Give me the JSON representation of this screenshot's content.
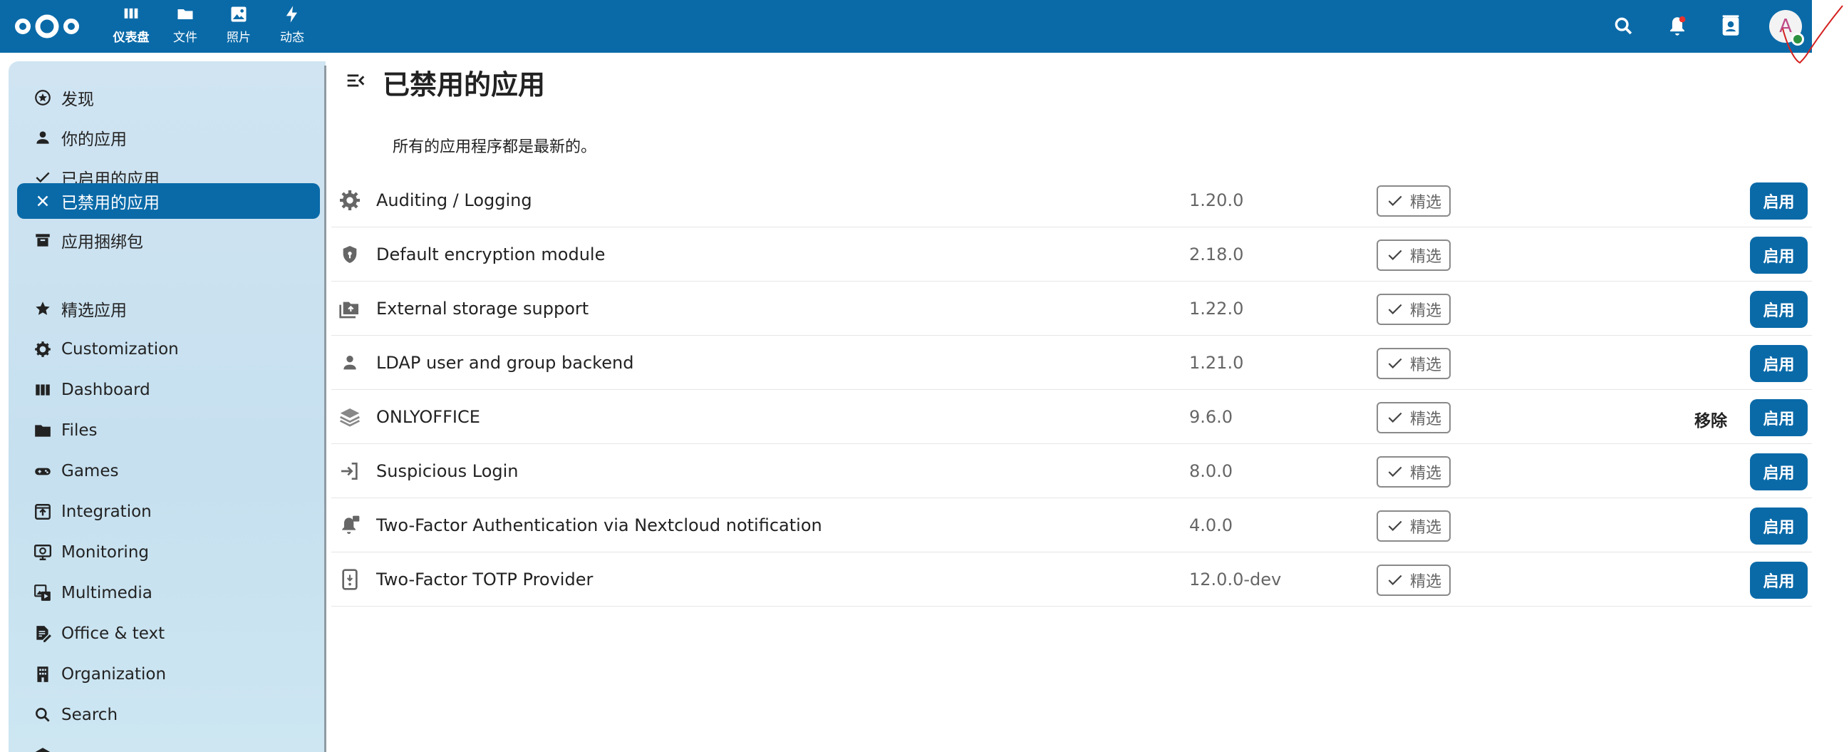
{
  "header": {
    "apps": [
      {
        "label": "仪表盘",
        "icon": "dashboard-icon",
        "active": true
      },
      {
        "label": "文件",
        "icon": "folder-icon",
        "active": false
      },
      {
        "label": "照片",
        "icon": "image-icon",
        "active": false
      },
      {
        "label": "动态",
        "icon": "lightning-icon",
        "active": false
      }
    ],
    "icons": [
      "search-icon",
      "bell-icon",
      "contacts-icon"
    ],
    "avatar_letter": "A",
    "brand_color": "#0a6aa8"
  },
  "sidebar": {
    "items": [
      {
        "label": "发现",
        "icon": "star-circle-icon"
      },
      {
        "label": "你的应用",
        "icon": "user-icon"
      },
      {
        "label": "已启用的应用",
        "icon": "check-icon"
      },
      {
        "label": "已禁用的应用",
        "icon": "close-icon",
        "active": true
      },
      {
        "label": "应用捆绑包",
        "icon": "archive-icon"
      }
    ],
    "categories": [
      {
        "label": "精选应用",
        "icon": "star-icon"
      },
      {
        "label": "Customization",
        "icon": "gear-icon"
      },
      {
        "label": "Dashboard",
        "icon": "dashboard-icon"
      },
      {
        "label": "Files",
        "icon": "folder-icon"
      },
      {
        "label": "Games",
        "icon": "gamepad-icon"
      },
      {
        "label": "Integration",
        "icon": "integration-icon"
      },
      {
        "label": "Monitoring",
        "icon": "monitor-icon"
      },
      {
        "label": "Multimedia",
        "icon": "multimedia-icon"
      },
      {
        "label": "Office & text",
        "icon": "document-edit-icon"
      },
      {
        "label": "Organization",
        "icon": "building-icon"
      },
      {
        "label": "Search",
        "icon": "search-icon"
      }
    ]
  },
  "main": {
    "title": "已禁用的应用",
    "uptodate": "所有的应用程序都是最新的。",
    "featured_label": "精选",
    "enable_label": "启用",
    "remove_label": "移除",
    "apps": [
      {
        "name": "Auditing / Logging",
        "version": "1.20.0",
        "icon": "gear-icon",
        "removable": false
      },
      {
        "name": "Default encryption module",
        "version": "2.18.0",
        "icon": "shield-icon",
        "removable": false
      },
      {
        "name": "External storage support",
        "version": "1.22.0",
        "icon": "external-storage-icon",
        "removable": false
      },
      {
        "name": "LDAP user and group backend",
        "version": "1.21.0",
        "icon": "user-icon",
        "removable": false
      },
      {
        "name": "ONLYOFFICE",
        "version": "9.6.0",
        "icon": "layers-icon",
        "removable": true
      },
      {
        "name": "Suspicious Login",
        "version": "8.0.0",
        "icon": "login-icon",
        "removable": false
      },
      {
        "name": "Two-Factor Authentication via Nextcloud notification",
        "version": "4.0.0",
        "icon": "bell-lock-icon",
        "removable": false
      },
      {
        "name": "Two-Factor TOTP Provider",
        "version": "12.0.0-dev",
        "icon": "totp-icon",
        "removable": false
      }
    ]
  }
}
